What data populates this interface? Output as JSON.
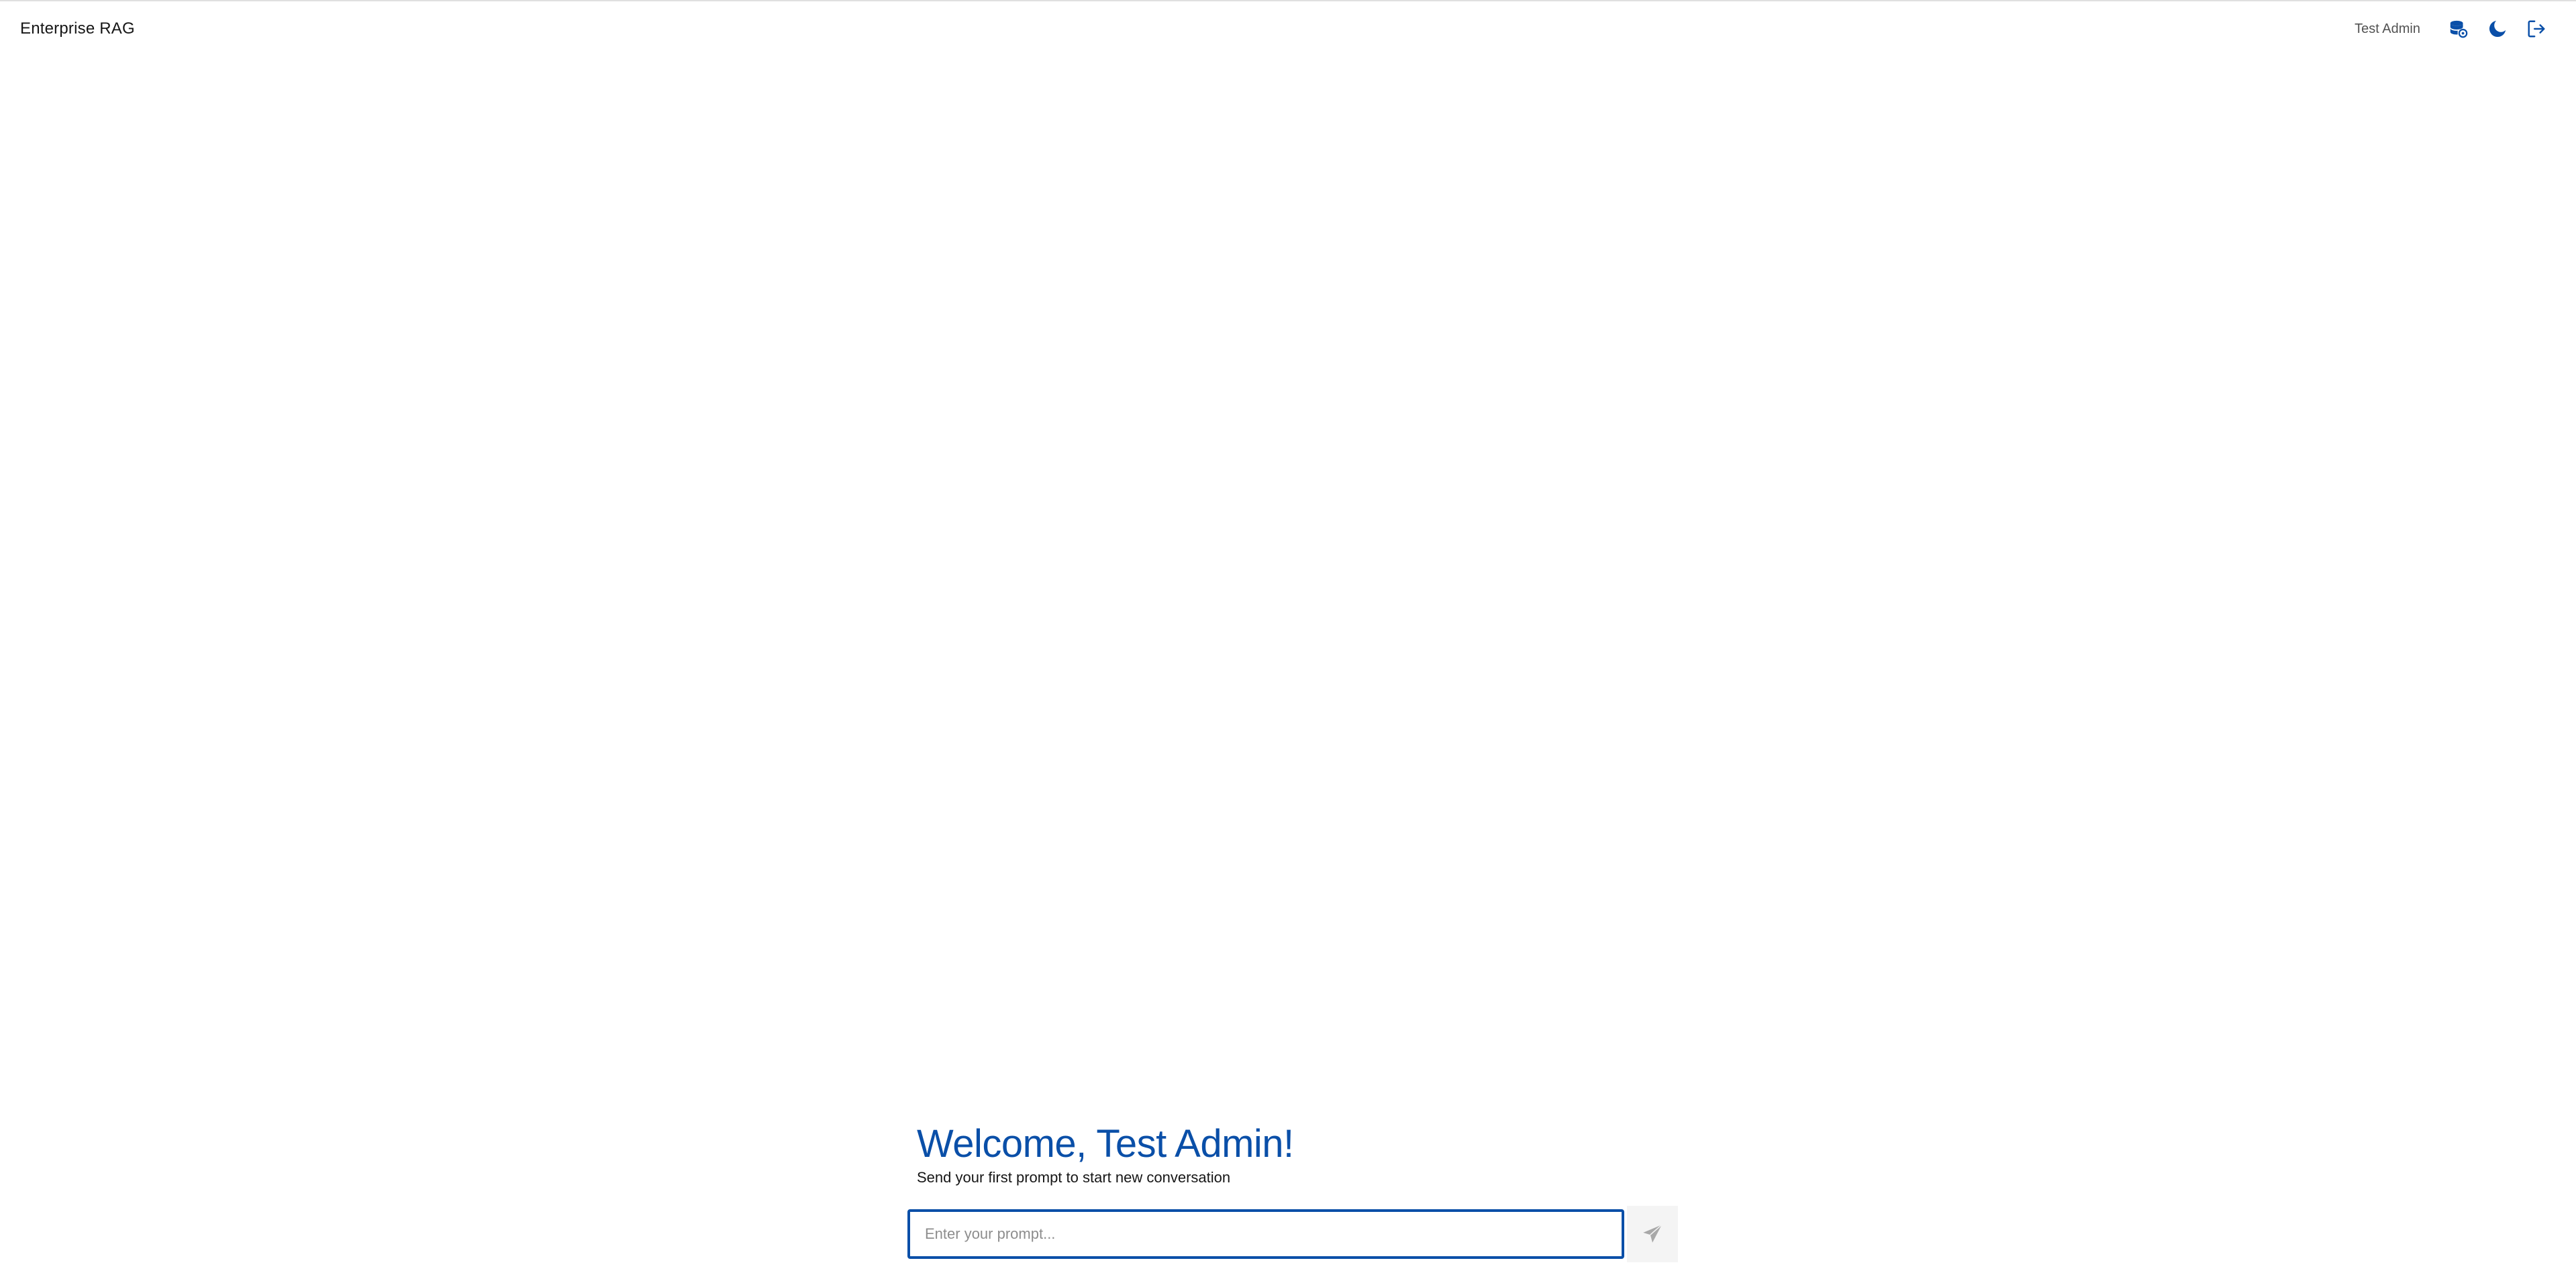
{
  "header": {
    "app_title": "Enterprise RAG",
    "username": "Test Admin",
    "icons": [
      "database-settings-icon",
      "moon-icon",
      "logout-icon"
    ]
  },
  "welcome": {
    "title": "Welcome, Test Admin!",
    "subtitle": "Send your first prompt to start new conversation"
  },
  "prompt": {
    "value": "",
    "placeholder": "Enter your prompt..."
  },
  "colors": {
    "accent": "#0a4fa8",
    "send_bg": "#f4f4f4",
    "send_icon": "#a8a8a8"
  }
}
